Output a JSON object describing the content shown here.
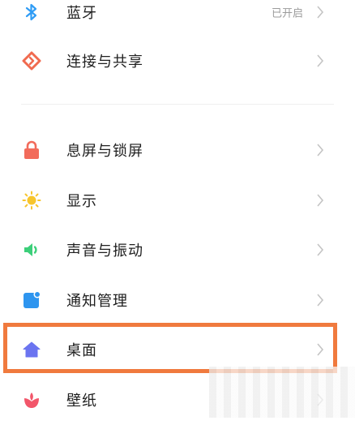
{
  "settings": {
    "items": [
      {
        "label": "蓝牙",
        "status": "已开启",
        "icon": "bluetooth-icon"
      },
      {
        "label": "连接与共享",
        "status": "",
        "icon": "connection-icon"
      },
      {
        "label": "息屏与锁屏",
        "status": "",
        "icon": "lock-icon"
      },
      {
        "label": "显示",
        "status": "",
        "icon": "brightness-icon"
      },
      {
        "label": "声音与振动",
        "status": "",
        "icon": "speaker-icon"
      },
      {
        "label": "通知管理",
        "status": "",
        "icon": "notification-icon"
      },
      {
        "label": "桌面",
        "status": "",
        "icon": "home-icon"
      },
      {
        "label": "壁纸",
        "status": "",
        "icon": "flower-icon"
      }
    ]
  },
  "colors": {
    "bluetooth": "#2f9cf5",
    "connection": "#f06a4f",
    "lock": "#f26b5b",
    "brightness": "#f7c52d",
    "speaker": "#3ccf7a",
    "notification": "#2e95ef",
    "home": "#6b74f0",
    "wallpaper": "#f2566a",
    "highlight_border": "#f07a3e",
    "chevron": "#c4c4c4"
  },
  "annotation": {
    "highlighted_item": "桌面"
  }
}
